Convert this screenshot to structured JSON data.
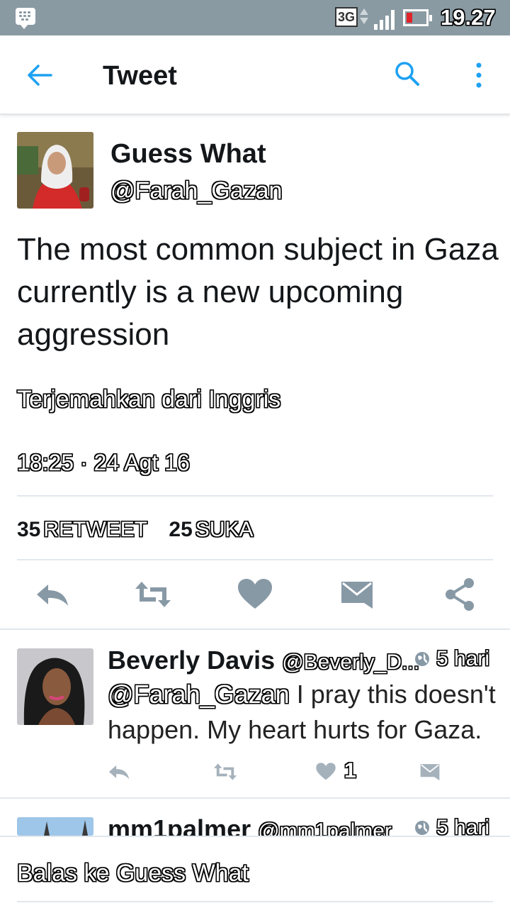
{
  "status_bar": {
    "network": "3G",
    "time": "19.27"
  },
  "app_bar": {
    "title": "Tweet",
    "back_icon": "arrow-left-icon",
    "search_icon": "search-icon",
    "more_icon": "more-vertical-icon"
  },
  "tweet": {
    "author_name": "Guess What",
    "author_handle": "@Farah_Gazan",
    "text": "The most common subject in Gaza currently is a new upcoming aggression",
    "translate_link": "Terjemahkan dari Inggris",
    "timestamp": "18:25 · 24 Agt 16",
    "retweet_count": "35",
    "retweet_label": "RETWEET",
    "like_count": "25",
    "like_label": "SUKA",
    "actions": [
      "reply-icon",
      "retweet-icon",
      "heart-icon",
      "message-icon",
      "share-icon"
    ]
  },
  "replies": [
    {
      "name": "Beverly Davis",
      "handle": "@Beverly_D...",
      "time": "5 hari",
      "mention": "@Farah_Gazan",
      "text": " I pray this doesn't happen. My heart hurts for Gaza.",
      "like_count": "1"
    },
    {
      "name": "mm1palmer",
      "handle": "@mm1palmer",
      "time": "5 hari"
    }
  ],
  "composer": {
    "placeholder": "Balas ke Guess What"
  },
  "colors": {
    "accent": "#1da1f2",
    "icon_gray": "#8899a6",
    "status_bar": "#8a9aa3"
  }
}
